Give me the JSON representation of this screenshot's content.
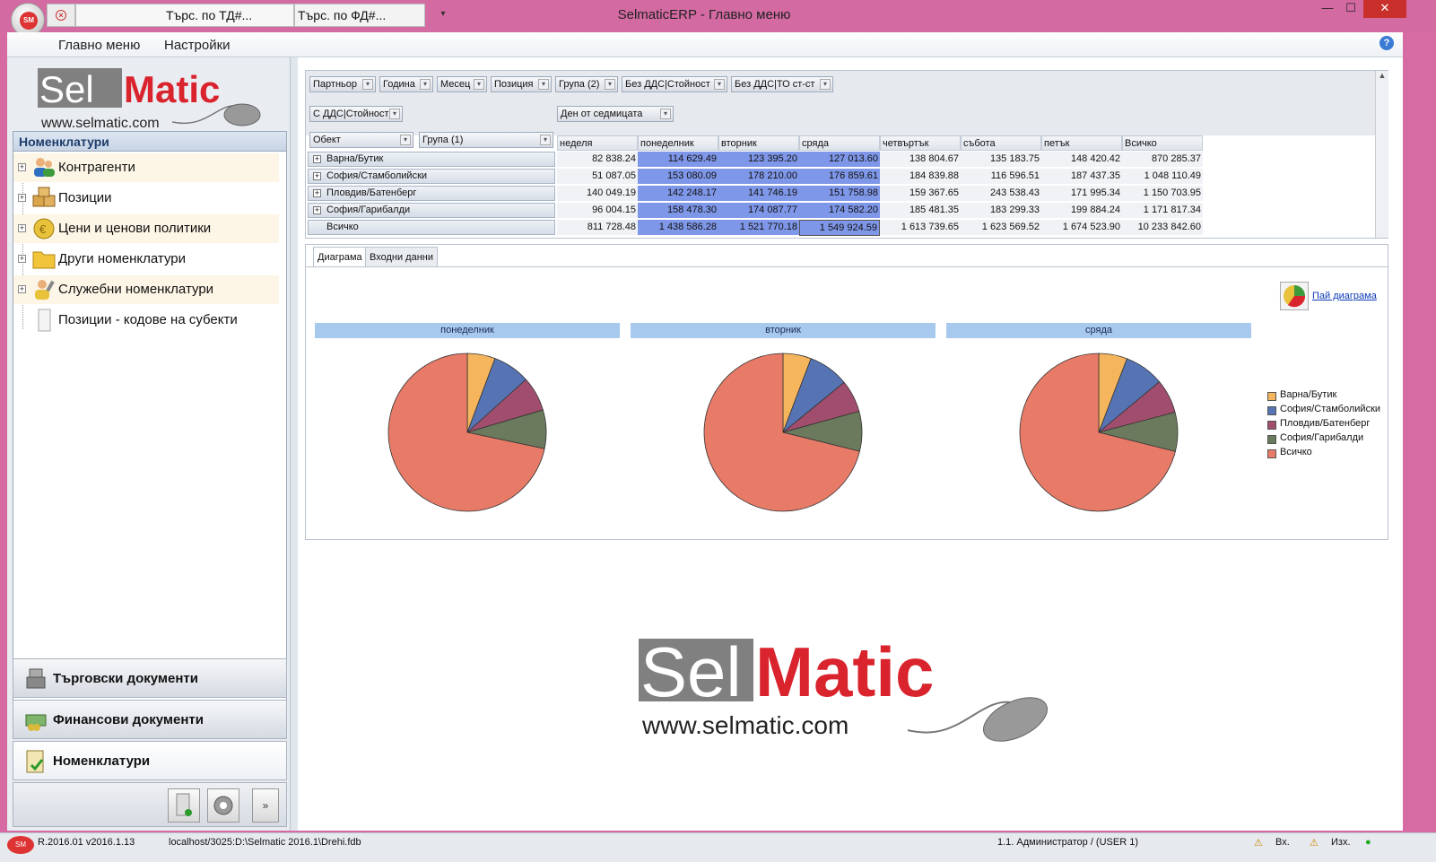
{
  "window": {
    "title": "SelmaticERP - Главно меню",
    "orb_label": "SM",
    "quick_tabs": [
      "Търс. по ТД#...",
      "Търс. по ФД#..."
    ]
  },
  "menu": {
    "main": "Главно меню",
    "settings": "Настройки"
  },
  "logo": {
    "sel": "Sel",
    "matic": "Matic",
    "url": "www.selmatic.com"
  },
  "nomenclatures": {
    "header": "Номенклатури",
    "items": [
      {
        "label": "Контрагенти"
      },
      {
        "label": "Позиции"
      },
      {
        "label": "Цени и ценови политики"
      },
      {
        "label": "Други номенклатури"
      },
      {
        "label": "Служебни номенклатури"
      },
      {
        "label": "Позиции - кодове на субекти"
      }
    ]
  },
  "nav_buttons": [
    "Търговски документи",
    "Финансови документи",
    "Номенклатури"
  ],
  "pivot": {
    "filter_fields": [
      "Партньор",
      "Година",
      "Месец",
      "Позиция",
      "Група (2)",
      "Без ДДС|Стойност",
      "Без ДДС|ТО ст-ст"
    ],
    "data_field": "С ДДС|Стойност",
    "column_field": "Ден от седмицата",
    "row_fields": [
      "Обект",
      "Група (1)"
    ],
    "columns": [
      "неделя",
      "понеделник",
      "вторник",
      "сряда",
      "четвъртък",
      "събота",
      "петък",
      "Всичко"
    ],
    "rows": [
      {
        "label": "Варна/Бутик",
        "values": [
          "82 838.24",
          "114 629.49",
          "123 395.20",
          "127 013.60",
          "138 804.67",
          "135 183.75",
          "148 420.42",
          "870 285.37"
        ]
      },
      {
        "label": "София/Стамболийски",
        "values": [
          "51 087.05",
          "153 080.09",
          "178 210.00",
          "176 859.61",
          "184 839.88",
          "116 596.51",
          "187 437.35",
          "1 048 110.49"
        ]
      },
      {
        "label": "Пловдив/Батенберг",
        "values": [
          "140 049.19",
          "142 248.17",
          "141 746.19",
          "151 758.98",
          "159 367.65",
          "243 538.43",
          "171 995.34",
          "1 150 703.95"
        ]
      },
      {
        "label": "София/Гарибалди",
        "values": [
          "96 004.15",
          "158 478.30",
          "174 087.77",
          "174 582.20",
          "185 481.35",
          "183 299.33",
          "199 884.24",
          "1 171 817.34"
        ]
      }
    ],
    "total": {
      "label": "Всичко",
      "values": [
        "811 728.48",
        "1 438 586.28",
        "1 521 770.18",
        "1 549 924.59",
        "1 613 739.65",
        "1 623 569.52",
        "1 674 523.90",
        "10 233 842.60"
      ]
    }
  },
  "tabs": [
    "Диаграма",
    "Входни данни"
  ],
  "pie_link": "Пай диаграма",
  "chart_data": [
    {
      "type": "pie",
      "title": "понеделник",
      "labels": [
        "Варна/Бутик",
        "София/Стамболийски",
        "Пловдив/Батенберг",
        "София/Гарибалди",
        "Всичко"
      ],
      "values": [
        114629.49,
        153080.09,
        142248.17,
        158478.3,
        1438586.28
      ]
    },
    {
      "type": "pie",
      "title": "вторник",
      "labels": [
        "Варна/Бутик",
        "София/Стамболийски",
        "Пловдив/Батенберг",
        "София/Гарибалди",
        "Всичко"
      ],
      "values": [
        123395.2,
        178210.0,
        141746.19,
        174087.77,
        1521770.18
      ]
    },
    {
      "type": "pie",
      "title": "сряда",
      "labels": [
        "Варна/Бутик",
        "София/Стамболийски",
        "Пловдив/Батенберг",
        "София/Гарибалди",
        "Всичко"
      ],
      "values": [
        127013.6,
        176859.61,
        151758.98,
        174582.2,
        1549924.59
      ]
    }
  ],
  "legend": [
    {
      "label": "Варна/Бутик",
      "color": "#f5b55c"
    },
    {
      "label": "София/Стамболийски",
      "color": "#5674b4"
    },
    {
      "label": "Пловдив/Батенберг",
      "color": "#a14e6e"
    },
    {
      "label": "София/Гарибалди",
      "color": "#6b7a5c"
    },
    {
      "label": "Всичко",
      "color": "#e87b68"
    }
  ],
  "status": {
    "version": "R.2016.01 v2016.1.13",
    "db_path": "localhost/3025:D:\\Selmatic 2016.1\\Drehi.fdb",
    "user": "1.1. Администратор / (USER 1)",
    "in": "Вх.",
    "out": "Изх."
  }
}
